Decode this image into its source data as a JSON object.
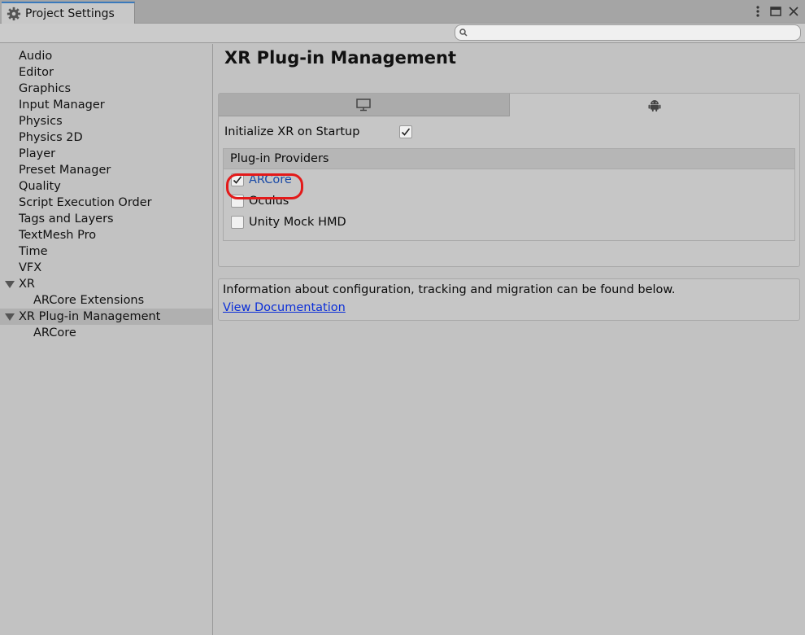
{
  "window": {
    "tab_title": "Project Settings"
  },
  "search": {
    "placeholder": "",
    "value": ""
  },
  "sidebar": {
    "items": [
      {
        "label": "Audio"
      },
      {
        "label": "Editor"
      },
      {
        "label": "Graphics"
      },
      {
        "label": "Input Manager"
      },
      {
        "label": "Physics"
      },
      {
        "label": "Physics 2D"
      },
      {
        "label": "Player"
      },
      {
        "label": "Preset Manager"
      },
      {
        "label": "Quality"
      },
      {
        "label": "Script Execution Order"
      },
      {
        "label": "Tags and Layers"
      },
      {
        "label": "TextMesh Pro"
      },
      {
        "label": "Time"
      },
      {
        "label": "VFX"
      },
      {
        "label": "XR"
      },
      {
        "label": "ARCore Extensions"
      },
      {
        "label": "XR Plug-in Management"
      },
      {
        "label": "ARCore"
      }
    ]
  },
  "main": {
    "title": "XR Plug-in Management",
    "platform_tabs": [
      {
        "icon": "desktop-icon"
      },
      {
        "icon": "android-icon"
      }
    ],
    "initialize_label": "Initialize XR on Startup",
    "initialize_checked": true,
    "providers_header": "Plug-in Providers",
    "providers": [
      {
        "label": "ARCore",
        "checked": true
      },
      {
        "label": "Oculus",
        "checked": false
      },
      {
        "label": "Unity Mock HMD",
        "checked": false
      }
    ],
    "info_text": "Information about configuration, tracking and migration can be found below.",
    "doc_link": "View Documentation"
  },
  "colors": {
    "annotation": "#e31a1a",
    "link": "#0a2ed8",
    "active_provider": "#1a4aa6"
  }
}
